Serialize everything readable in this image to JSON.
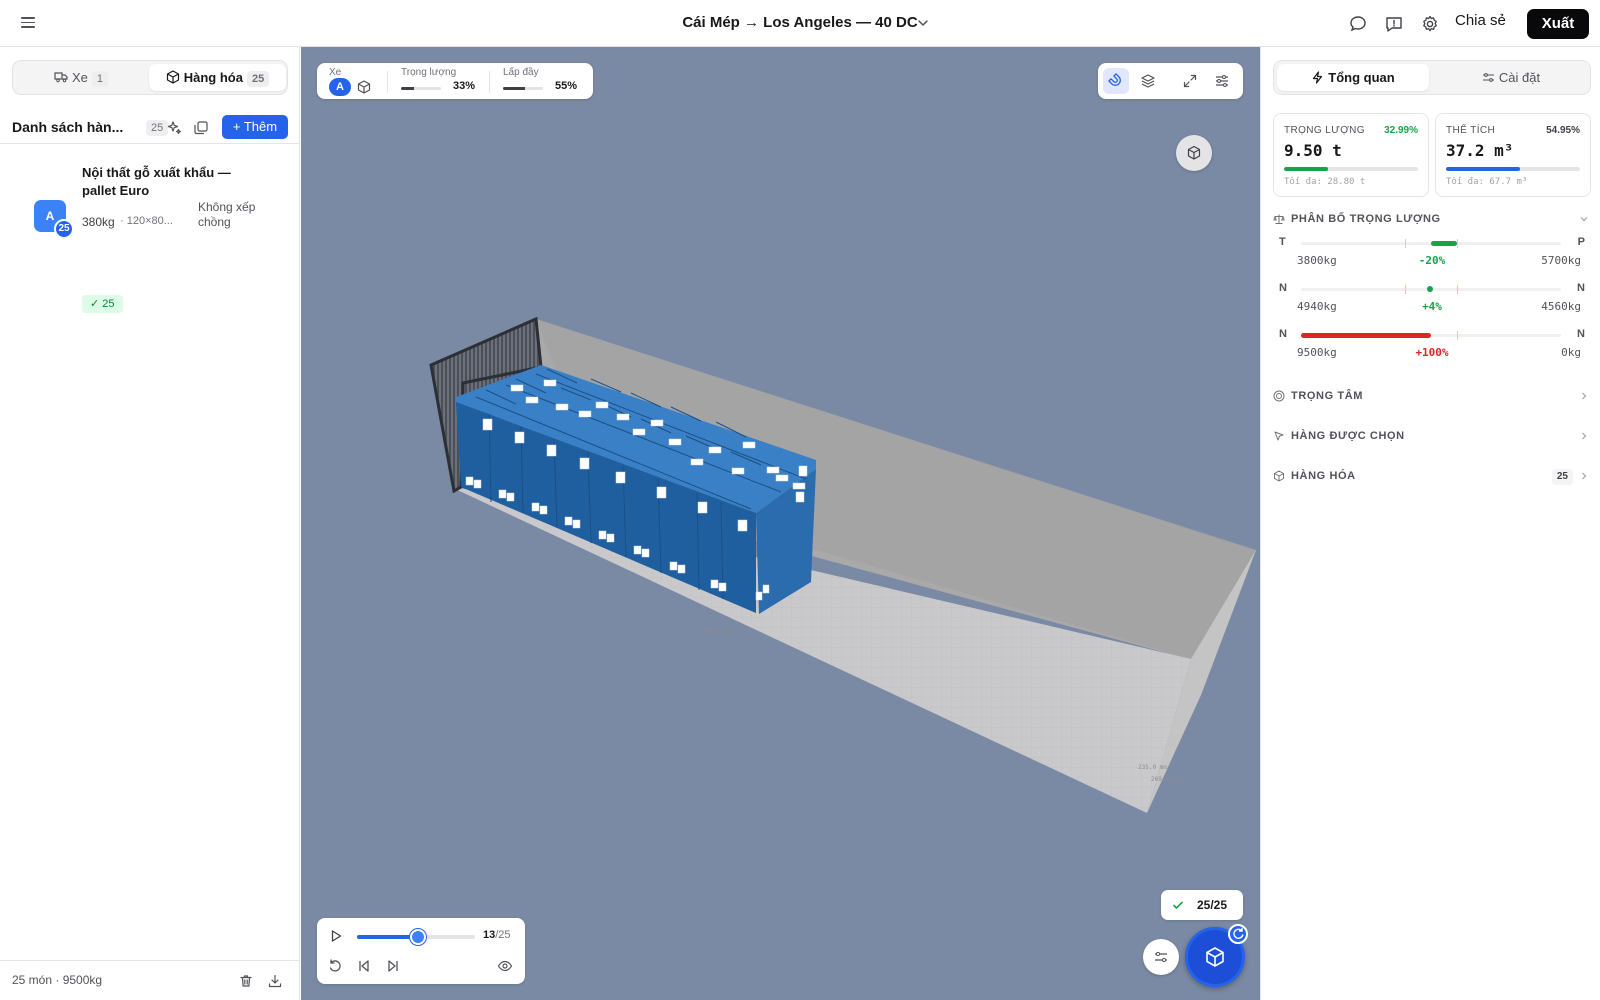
{
  "header": {
    "title": "Cái Mép → Los Angeles — 40 DC",
    "share_label": "Chia sẻ",
    "export_label": "Xuất"
  },
  "left_panel": {
    "tabs": [
      {
        "label": "Xe",
        "count": "1"
      },
      {
        "label": "Hàng hóa",
        "count": "25"
      }
    ],
    "list_title": "Danh sách hàn...",
    "list_count": "25",
    "add_label": "+ Thêm",
    "items": [
      {
        "avatar": "A",
        "avatar_count": "25",
        "name": "Nội thất gỗ xuất khẩu — pallet Euro",
        "weight": "380kg",
        "dims": "· 120×80...",
        "stacking": "Không xếp chồng",
        "placed_badge": "✓ 25"
      }
    ],
    "footer": {
      "summary": "25 món · 9500kg"
    }
  },
  "viewport": {
    "stats": {
      "vehicle_label": "Xe",
      "vehicle_chip": "A",
      "weight_label": "Trọng lượng",
      "weight_pct": "33%",
      "weight_fill": 0.33,
      "fill_label": "Lấp đầy",
      "fill_pct": "55%",
      "fill_fill": 0.55
    },
    "placed_status": "25/25",
    "player": {
      "current": "13",
      "total": "/25",
      "progress": 0.52
    }
  },
  "right_panel": {
    "tabs": [
      {
        "label": "Tổng quan"
      },
      {
        "label": "Cài đặt"
      }
    ],
    "weight_card": {
      "label": "TRỌNG LƯỢNG",
      "pct": "32.99%",
      "value": "9.50 t",
      "max": "Tối đa: 28.80 t",
      "fill": 0.33,
      "color": "#16a34a"
    },
    "volume_card": {
      "label": "THỂ TÍCH",
      "pct": "54.95%",
      "value": "37.2 m³",
      "max": "Tối đa: 67.7 m³",
      "fill": 0.55,
      "color": "#2563eb"
    },
    "distribution": {
      "title": "PHÂN BỐ TRỌNG LƯỢNG",
      "rows": [
        {
          "left": "T",
          "right": "P",
          "a": "3800kg",
          "mid": "-20%",
          "b": "5700kg",
          "color": "#16a34a"
        },
        {
          "left": "N",
          "right": "N",
          "a": "4940kg",
          "mid": "+4%",
          "b": "4560kg",
          "color": "#16a34a"
        },
        {
          "left": "N",
          "right": "N",
          "a": "9500kg",
          "mid": "+100%",
          "b": "0kg",
          "color": "#dc2626"
        }
      ]
    },
    "sections": [
      {
        "title": "TRỌNG TÂM"
      },
      {
        "title": "HÀNG ĐƯỢC CHỌN"
      },
      {
        "title": "HÀNG HÓA",
        "badge": "25"
      }
    ]
  }
}
